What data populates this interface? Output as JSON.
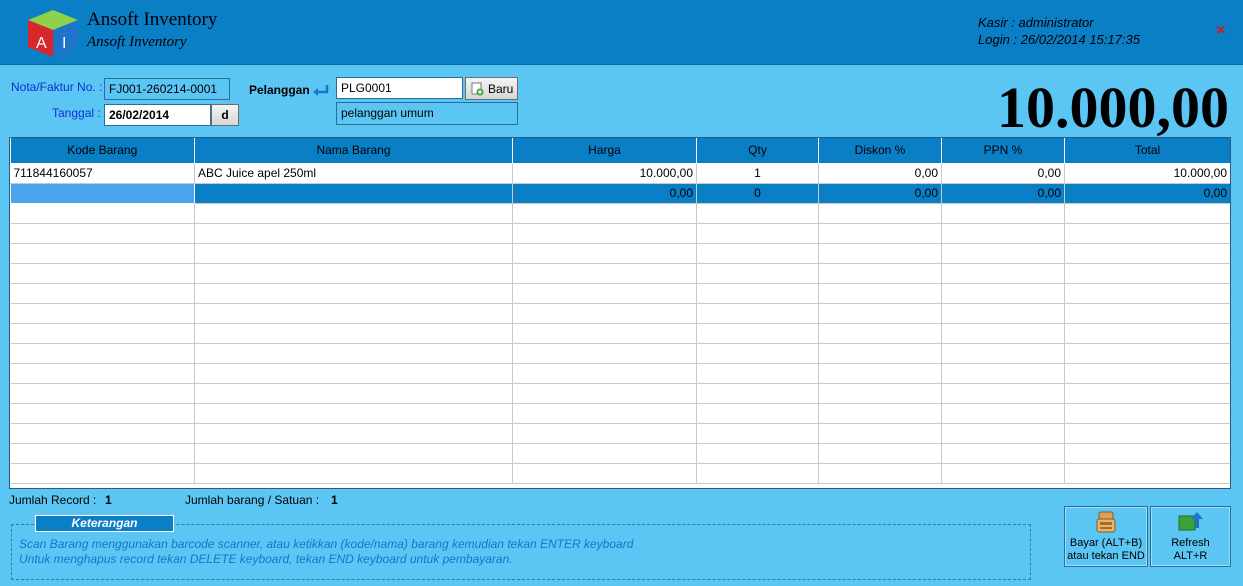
{
  "header": {
    "title": "Ansoft Inventory",
    "subtitle": "Ansoft Inventory",
    "kasir": "Kasir : administrator",
    "login": "Login : 26/02/2014 15:17:35",
    "close_icon": "×",
    "logo_letters": [
      "A",
      "I"
    ]
  },
  "form": {
    "nota_label": "Nota/Faktur No. :",
    "nota_value": "FJ001-260214-0001",
    "tanggal_label": "Tanggal :",
    "tanggal_value": "26/02/2014",
    "date_button": "d",
    "pelanggan_label": "Pelanggan",
    "pelanggan_code": "PLG0001",
    "pelanggan_name": "pelanggan umum",
    "baru_button": "Baru"
  },
  "total_display": "10.000,00",
  "table": {
    "columns": [
      "Kode Barang",
      "Nama Barang",
      "Harga",
      "Qty",
      "Diskon %",
      "PPN %",
      "Total"
    ],
    "rows": [
      [
        "711844160057",
        "ABC Juice apel 250ml",
        "10.000,00",
        "1",
        "0,00",
        "0,00",
        "10.000,00"
      ],
      [
        "",
        "",
        "0,00",
        "0",
        "0,00",
        "0,00",
        "0,00"
      ]
    ]
  },
  "status": {
    "jumlah_record_label": "Jumlah Record :",
    "jumlah_record_value": "1",
    "jumlah_barang_label": "Jumlah barang / Satuan :",
    "jumlah_barang_value": "1"
  },
  "keterangan": {
    "title": "Keterangan",
    "line1": "Scan Barang menggunakan barcode scanner, atau ketikkan (kode/nama) barang kemudian tekan ENTER keyboard",
    "line2": "Untuk menghapus record tekan DELETE keyboard, tekan END keyboard untuk pembayaran."
  },
  "buttons": {
    "bayar_line1": "Bayar (ALT+B)",
    "bayar_line2": "atau tekan END",
    "refresh_line1": "Refresh",
    "refresh_line2": "ALT+R"
  },
  "colors": {
    "header_bg": "#0a7fc6",
    "body_bg": "#5bc6f4",
    "label_blue": "#0f2fd1",
    "close_red": "#d8161d"
  }
}
